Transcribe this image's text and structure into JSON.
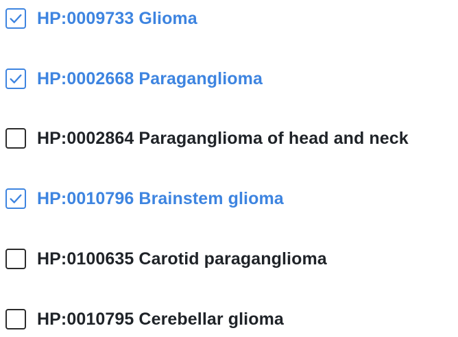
{
  "terms": [
    {
      "label": "HP:0009733 Glioma",
      "checked": true
    },
    {
      "label": "HP:0002668 Paraganglioma",
      "checked": true
    },
    {
      "label": "HP:0002864 Paraganglioma of head and neck",
      "checked": false
    },
    {
      "label": "HP:0010796 Brainstem glioma",
      "checked": true
    },
    {
      "label": "HP:0100635 Carotid paraganglioma",
      "checked": false
    },
    {
      "label": "HP:0010795 Cerebellar glioma",
      "checked": false
    }
  ],
  "colors": {
    "checked_accent": "#3d84e0",
    "unchecked_text": "#1f2328",
    "unchecked_border": "#2b2b2b"
  },
  "icons": {
    "checked": "checkmark-icon"
  }
}
